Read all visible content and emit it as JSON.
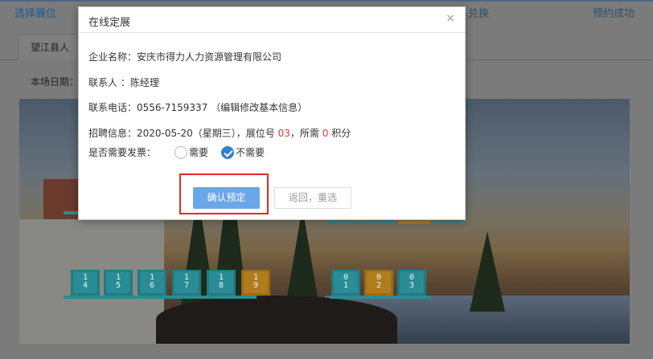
{
  "steps": [
    {
      "label": "选择展位"
    },
    {
      "label": "兑换"
    },
    {
      "label": "预约成功"
    }
  ],
  "tab": {
    "label": "望江县人"
  },
  "date_label": "本场日期：",
  "seats_left": [
    "1\n4",
    "1\n5",
    "1\n6",
    "1\n7",
    "1\n8",
    "1\n9"
  ],
  "seats_right": [
    "0\n1",
    "0\n2",
    "0\n3"
  ],
  "modal": {
    "title": "在线定展",
    "close": "×",
    "company_label": "企业名称：",
    "company_value": "安庆市得力人力资源管理有限公司",
    "contact_label": "联系人 ：",
    "contact_value": "陈经理",
    "phone_label": "联系电话：",
    "phone_value": "0556-7159337",
    "phone_note": "（编辑修改基本信息）",
    "recruit_label": "招聘信息：",
    "recruit_prefix": "2020-05-20（星期三），展位号",
    "booth_no": "03",
    "recruit_mid": "，所需",
    "points": "0",
    "recruit_suffix": "积分",
    "invoice_label": "是否需要发票：",
    "invoice_options": [
      {
        "label": "需要",
        "checked": false
      },
      {
        "label": "不需要",
        "checked": true
      }
    ],
    "confirm_label": "确认预定",
    "back_label": "返回，重选"
  },
  "colors": {
    "accent": "#6aa6ea",
    "highlight_border": "#e02b2b",
    "radio_checked": "#2e83c9",
    "number_red": "#e33"
  }
}
